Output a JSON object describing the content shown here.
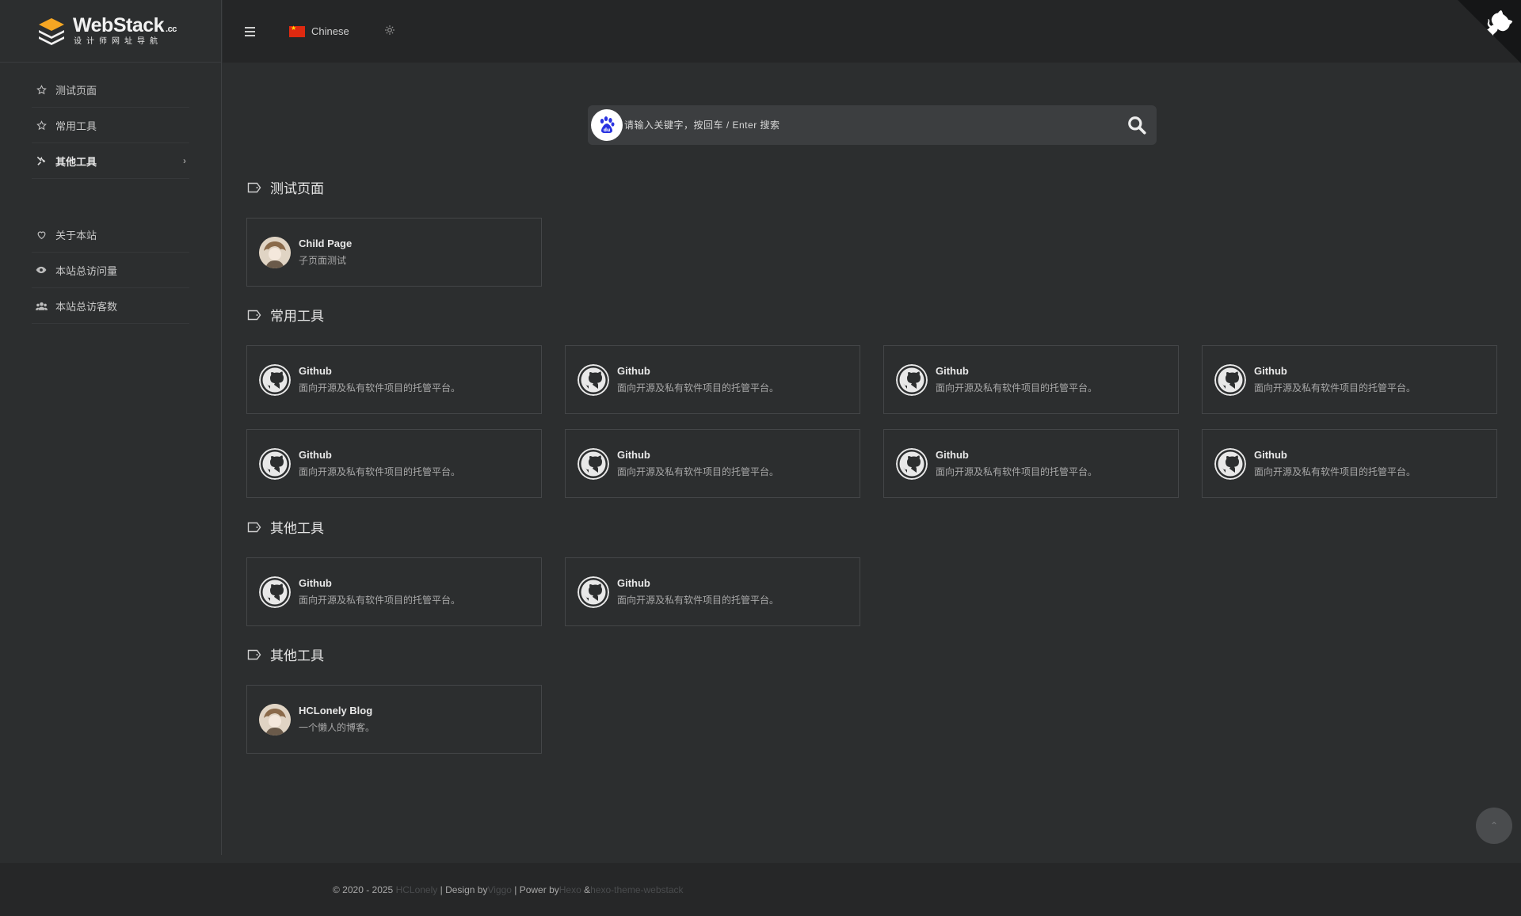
{
  "brand": {
    "name": "WebStack",
    "suffix": ".cc",
    "tagline": "设计师网址导航"
  },
  "sidebar": {
    "items": [
      {
        "label": "测试页面",
        "icon": "star-icon"
      },
      {
        "label": "常用工具",
        "icon": "star-icon"
      },
      {
        "label": "其他工具",
        "icon": "tools-icon",
        "active": true
      }
    ],
    "bottom_items": [
      {
        "label": "关于本站",
        "icon": "heart-icon"
      },
      {
        "label": "本站总访问量",
        "icon": "eye-icon"
      },
      {
        "label": "本站总访客数",
        "icon": "users-icon"
      }
    ]
  },
  "topbar": {
    "language": "Chinese",
    "theme_icon": "sun-icon"
  },
  "search": {
    "placeholder": "请输入关键字，按回车 / Enter 搜索",
    "engine": "baidu"
  },
  "sections": [
    {
      "title": "测试页面",
      "cards": [
        {
          "title": "Child Page",
          "desc": "子页面测试",
          "avatar": "person-avatar"
        }
      ]
    },
    {
      "title": "常用工具",
      "cards": [
        {
          "title": "Github",
          "desc": "面向开源及私有软件项目的托管平台。",
          "avatar": "github-icon"
        },
        {
          "title": "Github",
          "desc": "面向开源及私有软件项目的托管平台。",
          "avatar": "github-icon"
        },
        {
          "title": "Github",
          "desc": "面向开源及私有软件项目的托管平台。",
          "avatar": "github-icon"
        },
        {
          "title": "Github",
          "desc": "面向开源及私有软件项目的托管平台。",
          "avatar": "github-icon"
        },
        {
          "title": "Github",
          "desc": "面向开源及私有软件项目的托管平台。",
          "avatar": "github-icon"
        },
        {
          "title": "Github",
          "desc": "面向开源及私有软件项目的托管平台。",
          "avatar": "github-icon"
        },
        {
          "title": "Github",
          "desc": "面向开源及私有软件项目的托管平台。",
          "avatar": "github-icon"
        },
        {
          "title": "Github",
          "desc": "面向开源及私有软件项目的托管平台。",
          "avatar": "github-icon"
        }
      ]
    },
    {
      "title": "其他工具",
      "cards": [
        {
          "title": "Github",
          "desc": "面向开源及私有软件项目的托管平台。",
          "avatar": "github-icon"
        },
        {
          "title": "Github",
          "desc": "面向开源及私有软件项目的托管平台。",
          "avatar": "github-icon"
        }
      ]
    },
    {
      "title": "其他工具",
      "cards": [
        {
          "title": "HCLonely Blog",
          "desc": "一个懒人的博客。",
          "avatar": "person-avatar"
        }
      ]
    }
  ],
  "footer": {
    "copyright": "© 2020 - 2025",
    "author": "HCLonely",
    "design_by": "| Design by",
    "designer": "Viggo",
    "power_by": "| Power by",
    "engine": "Hexo",
    "amp": "&",
    "theme": "hexo-theme-webstack"
  },
  "colors": {
    "background": "#2c2e2f",
    "topbar": "#252627",
    "card_border": "#444648",
    "accent_logo": "#f5a623"
  }
}
